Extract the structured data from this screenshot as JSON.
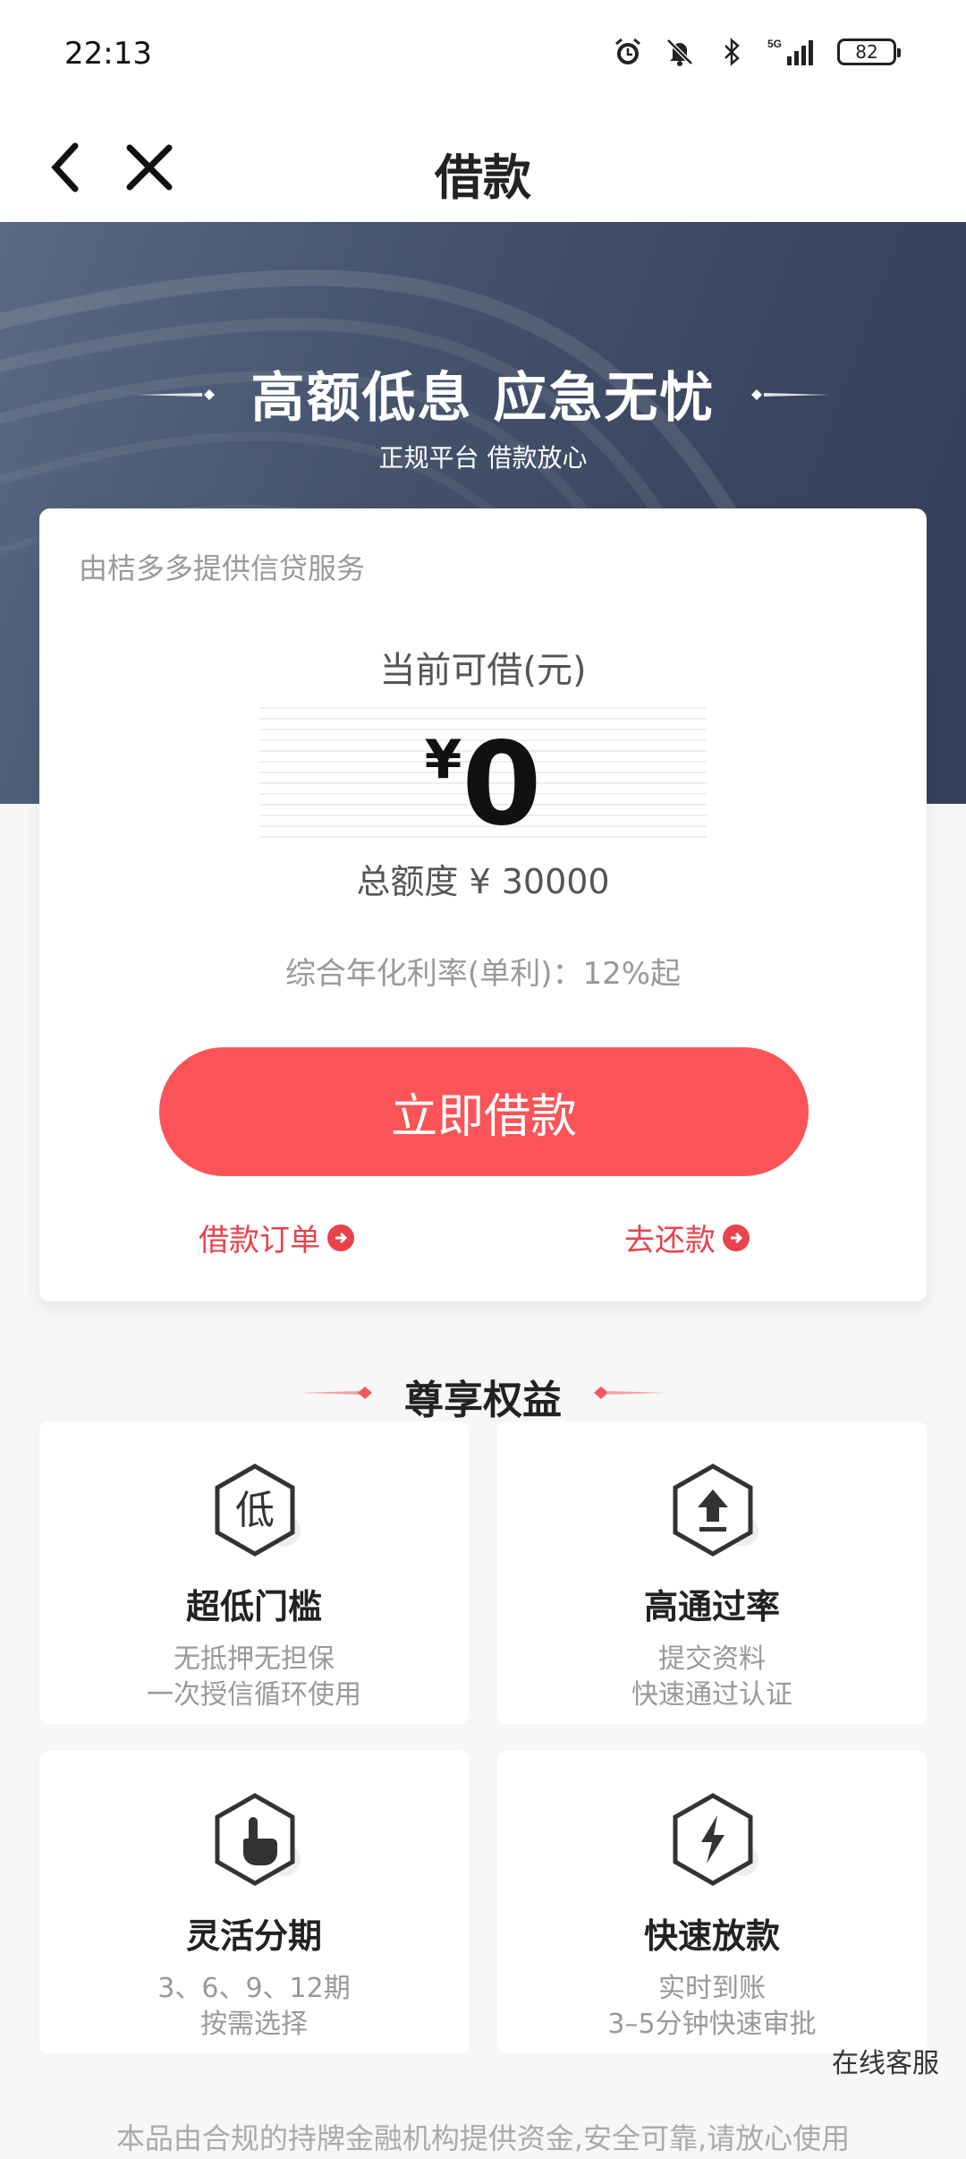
{
  "status_bar": {
    "time": "22:13",
    "network": "5G",
    "battery": "82"
  },
  "nav": {
    "title": "借款"
  },
  "banner": {
    "title": "高额低息 应急无忧",
    "subtitle": "正规平台 借款放心"
  },
  "card": {
    "provider": "由桔多多提供信贷服务",
    "available_label": "当前可借(元)",
    "currency": "¥",
    "amount": "0",
    "total_limit": "总额度 ¥ 30000",
    "rate": "综合年化利率(单利)：12%起",
    "borrow_button": "立即借款",
    "orders_link": "借款订单",
    "repay_link": "去还款"
  },
  "benefits": {
    "title": "尊享权益",
    "items": [
      {
        "badge": "低",
        "title": "超低门槛",
        "line1": "无抵押无担保",
        "line2": "一次授信循环使用",
        "icon": "low-icon"
      },
      {
        "badge": "",
        "title": "高通过率",
        "line1": "提交资料",
        "line2": "快速通过认证",
        "icon": "upload-arrow-icon"
      },
      {
        "badge": "",
        "title": "灵活分期",
        "line1": "3、6、9、12期",
        "line2": "按需选择",
        "icon": "tap-hand-icon"
      },
      {
        "badge": "",
        "title": "快速放款",
        "line1": "实时到账",
        "line2": "3–5分钟快速审批",
        "icon": "lightning-icon"
      }
    ]
  },
  "service": "在线客服",
  "footer": "本品由合规的持牌金融机构提供资金,安全可靠,请放心使用",
  "colors": {
    "accent": "#fa5458",
    "link": "#e8424a",
    "banner": "#44526c"
  }
}
